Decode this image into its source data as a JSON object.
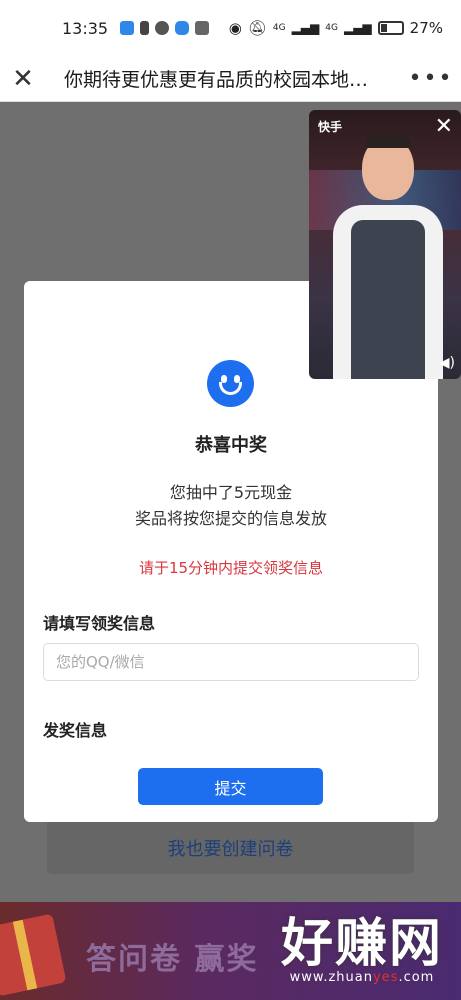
{
  "status_bar": {
    "time": "13:35",
    "network_a": "4G",
    "network_b": "4G",
    "battery": "27%"
  },
  "nav": {
    "close_icon": "close-icon",
    "title": "你期待更优惠更有品质的校园本地…",
    "more_icon": "more-dots-icon"
  },
  "background": {
    "create_link": "我也要创建问卷",
    "banner_text": "答问卷 赢奖",
    "watermark_main": "好赚网",
    "watermark_url_a": "www.zhuan",
    "watermark_url_b": "yes",
    "watermark_url_c": ".com"
  },
  "modal": {
    "icon": "smiley-icon",
    "title": "恭喜中奖",
    "line1": "您抽中了5元现金",
    "line2": "奖品将按您提交的信息发放",
    "warning": "请于15分钟内提交领奖信息",
    "label_contact": "请填写领奖信息",
    "contact_placeholder": "您的QQ/微信",
    "label_award": "发奖信息",
    "submit_label": "提交"
  },
  "video": {
    "logo": "快手",
    "close_icon": "close-icon",
    "sound_icon": "speaker-icon"
  },
  "colors": {
    "accent": "#1e6ff0",
    "warning": "#d9363e"
  }
}
